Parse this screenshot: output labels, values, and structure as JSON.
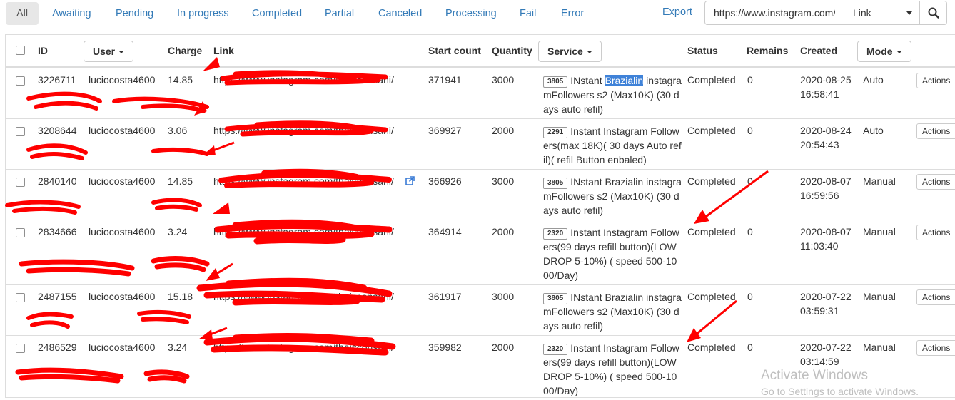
{
  "filters": {
    "tabs": [
      {
        "label": "All",
        "active": true
      },
      {
        "label": "Awaiting"
      },
      {
        "label": "Pending"
      },
      {
        "label": "In progress"
      },
      {
        "label": "Completed"
      },
      {
        "label": "Partial"
      },
      {
        "label": "Canceled"
      },
      {
        "label": "Processing"
      },
      {
        "label": "Fail"
      },
      {
        "label": "Error"
      }
    ],
    "export_label": "Export"
  },
  "search": {
    "value": "https://www.instagram.com/",
    "type_selected": "Link",
    "icon": "search-icon"
  },
  "table": {
    "headers": {
      "id": "ID",
      "user": "User",
      "charge": "Charge",
      "link": "Link",
      "start_count": "Start count",
      "quantity": "Quantity",
      "service": "Service",
      "status": "Status",
      "remains": "Remains",
      "created": "Created",
      "mode": "Mode"
    },
    "actions_label": "Actions",
    "rows": [
      {
        "id": "3226711",
        "user": "luciocosta4600",
        "charge": "14.85",
        "link": "https://www.instagram.com/thaisconsani/",
        "start_count": "371941",
        "quantity": "3000",
        "service_id": "3805",
        "service_pre": "INstant ",
        "service_hl": "Brazialin",
        "service_post": " instagramFollowers s2 (Max10K) (30 days auto refil)",
        "status": "Completed",
        "remains": "0",
        "created_date": "2020-08-25",
        "created_time": "16:58:41",
        "mode": "Auto"
      },
      {
        "id": "3208644",
        "user": "luciocosta4600",
        "charge": "3.06",
        "link": "https://www.instagram.com/thaisconsani/",
        "start_count": "369927",
        "quantity": "2000",
        "service_id": "2291",
        "service_pre": "Instant Instagram Followers(max 18K)( 30 days Auto refil)( refil Button enbaled)",
        "service_hl": "",
        "service_post": "",
        "status": "Completed",
        "remains": "0",
        "created_date": "2020-08-24",
        "created_time": "20:54:43",
        "mode": "Auto"
      },
      {
        "id": "2840140",
        "user": "luciocosta4600",
        "charge": "14.85",
        "link": "https://www.instagram.com/thaisconsani/",
        "start_count": "366926",
        "quantity": "3000",
        "service_id": "3805",
        "service_pre": "INstant Brazialin instagramFollowers s2 (Max10K) (30 days auto refil)",
        "service_hl": "",
        "service_post": "",
        "status": "Completed",
        "remains": "0",
        "created_date": "2020-08-07",
        "created_time": "16:59:56",
        "mode": "Manual"
      },
      {
        "id": "2834666",
        "user": "luciocosta4600",
        "charge": "3.24",
        "link": "https://www.instagram.com/thaisconsani/",
        "start_count": "364914",
        "quantity": "2000",
        "service_id": "2320",
        "service_pre": "Instant Instagram Followers(99 days refill button)(LOW DROP 5-10%) ( speed 500-1000/Day)",
        "service_hl": "",
        "service_post": "",
        "status": "Completed",
        "remains": "0",
        "created_date": "2020-08-07",
        "created_time": "11:03:40",
        "mode": "Manual"
      },
      {
        "id": "2487155",
        "user": "luciocosta4600",
        "charge": "15.18",
        "link": "https://www.instagram.com/thaisconsani/",
        "start_count": "361917",
        "quantity": "3000",
        "service_id": "3805",
        "service_pre": "INstant Brazialin instagramFollowers s2 (Max10K) (30 days auto refil)",
        "service_hl": "",
        "service_post": "",
        "status": "Completed",
        "remains": "0",
        "created_date": "2020-07-22",
        "created_time": "03:59:31",
        "mode": "Manual"
      },
      {
        "id": "2486529",
        "user": "luciocosta4600",
        "charge": "3.24",
        "link": "https://www.instagram.com/thaisconsani/",
        "start_count": "359982",
        "quantity": "2000",
        "service_id": "2320",
        "service_pre": "Instant Instagram Followers(99 days refill button)(LOW DROP 5-10%) ( speed 500-1000/Day)",
        "service_hl": "",
        "service_post": "",
        "status": "Completed",
        "remains": "0",
        "created_date": "2020-07-22",
        "created_time": "03:14:59",
        "mode": "Manual"
      }
    ]
  },
  "watermark": {
    "title": "Activate Windows",
    "subtitle": "Go to Settings to activate Windows."
  },
  "colors": {
    "link": "#337ab7",
    "annotation_red": "#ff0000",
    "selection_highlight": "#3f82d8",
    "border": "#dddddd"
  }
}
